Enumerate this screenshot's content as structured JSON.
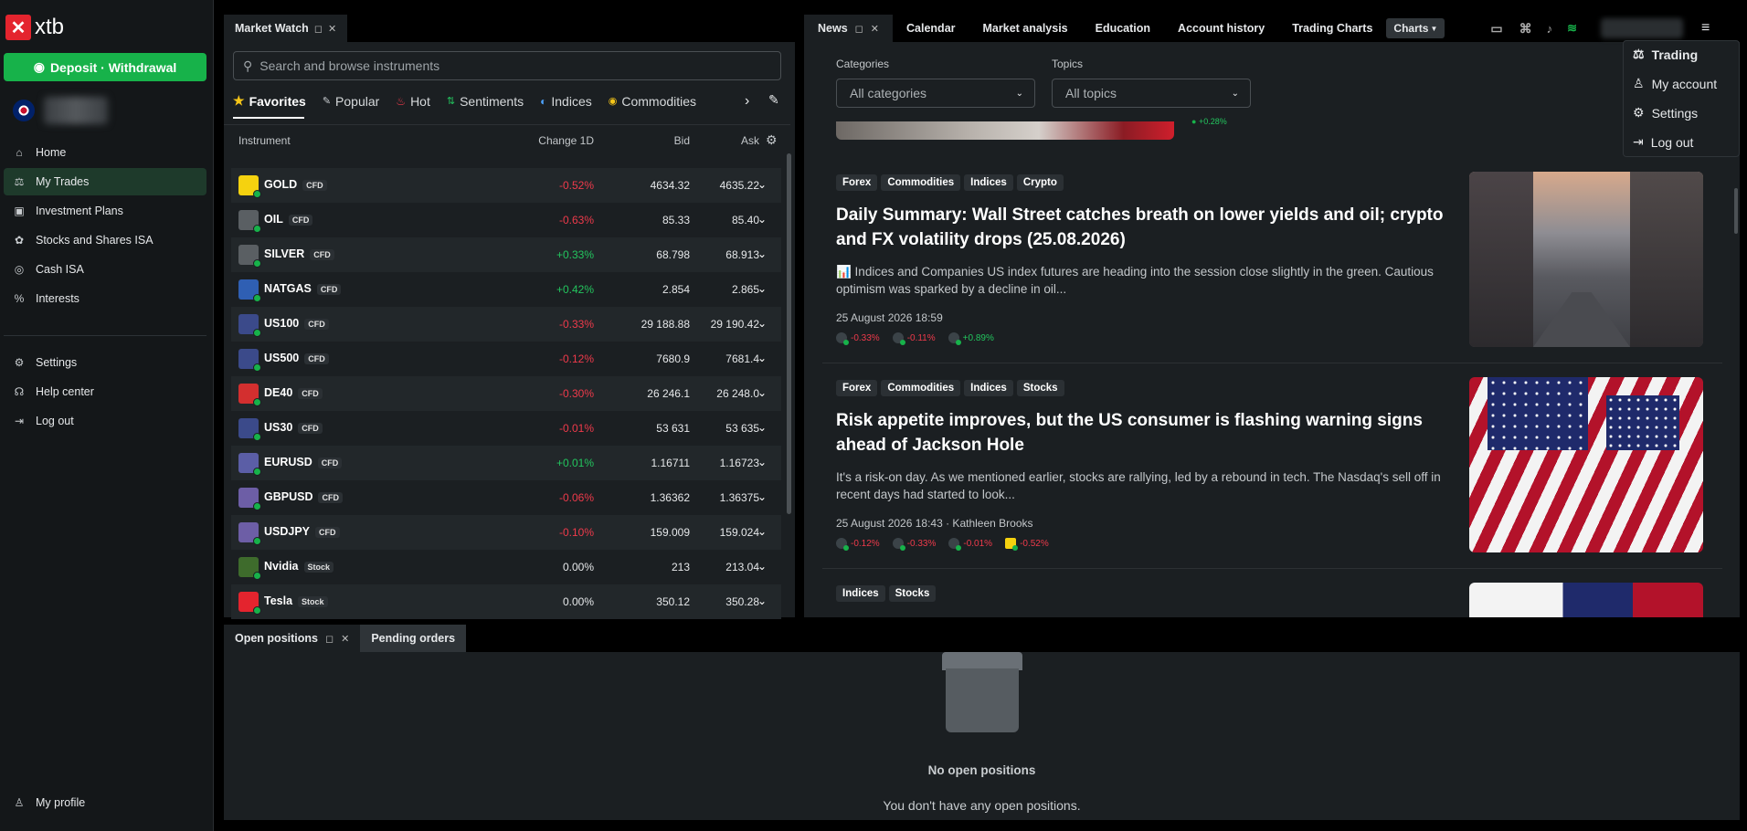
{
  "brand": {
    "name": "xtb",
    "accent": "#e4242e",
    "green": "#17b24a"
  },
  "sidebar": {
    "deposit_label": "Deposit · Withdrawal",
    "items": [
      {
        "label": "Home",
        "icon": "home-icon"
      },
      {
        "label": "My Trades",
        "icon": "trades-icon"
      },
      {
        "label": "Investment Plans",
        "icon": "plans-icon"
      },
      {
        "label": "Stocks and Shares ISA",
        "icon": "isa-icon"
      },
      {
        "label": "Cash ISA",
        "icon": "cash-icon"
      },
      {
        "label": "Interests",
        "icon": "percent-icon"
      }
    ],
    "bottom_items": [
      {
        "label": "Settings",
        "icon": "gear-icon"
      },
      {
        "label": "Help center",
        "icon": "headset-icon"
      },
      {
        "label": "Log out",
        "icon": "logout-icon"
      }
    ],
    "profile_label": "My profile"
  },
  "market_watch": {
    "tab_label": "Market Watch",
    "search_placeholder": "Search and browse instruments",
    "categories": [
      "Favorites",
      "Popular",
      "Hot",
      "Sentiments",
      "Indices",
      "Commodities"
    ],
    "columns": {
      "instrument": "Instrument",
      "change": "Change 1D",
      "bid": "Bid",
      "ask": "Ask"
    },
    "rows": [
      {
        "symbol": "GOLD",
        "type": "CFD",
        "change": "-0.52%",
        "bid": "4634.32",
        "ask": "4635.22",
        "dir": "neg"
      },
      {
        "symbol": "OIL",
        "type": "CFD",
        "change": "-0.63%",
        "bid": "85.33",
        "ask": "85.40",
        "dir": "neg"
      },
      {
        "symbol": "SILVER",
        "type": "CFD",
        "change": "+0.33%",
        "bid": "68.798",
        "ask": "68.913",
        "dir": "pos"
      },
      {
        "symbol": "NATGAS",
        "type": "CFD",
        "change": "+0.42%",
        "bid": "2.854",
        "ask": "2.865",
        "dir": "pos"
      },
      {
        "symbol": "US100",
        "type": "CFD",
        "change": "-0.33%",
        "bid": "29 188.88",
        "ask": "29 190.42",
        "dir": "neg"
      },
      {
        "symbol": "US500",
        "type": "CFD",
        "change": "-0.12%",
        "bid": "7680.9",
        "ask": "7681.4",
        "dir": "neg"
      },
      {
        "symbol": "DE40",
        "type": "CFD",
        "change": "-0.30%",
        "bid": "26 246.1",
        "ask": "26 248.0",
        "dir": "neg"
      },
      {
        "symbol": "US30",
        "type": "CFD",
        "change": "-0.01%",
        "bid": "53 631",
        "ask": "53 635",
        "dir": "neg"
      },
      {
        "symbol": "EURUSD",
        "type": "CFD",
        "change": "+0.01%",
        "bid": "1.16711",
        "ask": "1.16723",
        "dir": "pos"
      },
      {
        "symbol": "GBPUSD",
        "type": "CFD",
        "change": "-0.06%",
        "bid": "1.36362",
        "ask": "1.36375",
        "dir": "neg"
      },
      {
        "symbol": "USDJPY",
        "type": "CFD",
        "change": "-0.10%",
        "bid": "159.009",
        "ask": "159.024",
        "dir": "neg"
      },
      {
        "symbol": "Nvidia",
        "type": "Stock",
        "change": "0.00%",
        "bid": "213",
        "ask": "213.04",
        "dir": "zero"
      },
      {
        "symbol": "Tesla",
        "type": "Stock",
        "change": "0.00%",
        "bid": "350.12",
        "ask": "350.28",
        "dir": "zero"
      }
    ]
  },
  "news": {
    "tabs": [
      "News",
      "Calendar",
      "Market analysis",
      "Education",
      "Account history",
      "Trading Charts",
      "Charts"
    ],
    "categories_label": "Categories",
    "categories_value": "All categories",
    "topics_label": "Topics",
    "topics_value": "All topics",
    "top_chip": "+0.28%",
    "articles": [
      {
        "tags": [
          "Forex",
          "Commodities",
          "Indices",
          "Crypto"
        ],
        "title": "Daily Summary: Wall Street catches breath on lower yields and oil; crypto and FX volatility drops (25.08.2026)",
        "body": "📊 Indices and Companies US index futures are heading into the session close slightly in the green. Cautious optimism was sparked by a decline in oil...",
        "date": "25 August 2026 18:59",
        "chips": [
          {
            "v": "-0.33%",
            "d": "neg"
          },
          {
            "v": "-0.11%",
            "d": "neg"
          },
          {
            "v": "+0.89%",
            "d": "pos"
          }
        ]
      },
      {
        "tags": [
          "Forex",
          "Commodities",
          "Indices",
          "Stocks"
        ],
        "title": "Risk appetite improves, but the US consumer is flashing warning signs ahead of Jackson Hole",
        "body": "It's a risk-on day. As we mentioned earlier, stocks are rallying, led by a rebound in tech. The Nasdaq's sell off in recent days had started to look...",
        "date": "25 August 2026 18:43 · Kathleen Brooks",
        "chips": [
          {
            "v": "-0.12%",
            "d": "neg"
          },
          {
            "v": "-0.33%",
            "d": "neg"
          },
          {
            "v": "-0.01%",
            "d": "neg"
          },
          {
            "v": "-0.52%",
            "d": "neg"
          }
        ]
      },
      {
        "tags": [
          "Indices",
          "Stocks"
        ]
      }
    ]
  },
  "user_menu": {
    "items": [
      {
        "label": "Trading",
        "icon": "trading-icon"
      },
      {
        "label": "My account",
        "icon": "user-icon"
      },
      {
        "label": "Settings",
        "icon": "gear-icon"
      },
      {
        "label": "Log out",
        "icon": "logout-icon"
      }
    ]
  },
  "positions": {
    "tabs": [
      "Open positions",
      "Pending orders"
    ],
    "empty_title": "No open positions",
    "empty_text": "You don't have any open positions."
  }
}
